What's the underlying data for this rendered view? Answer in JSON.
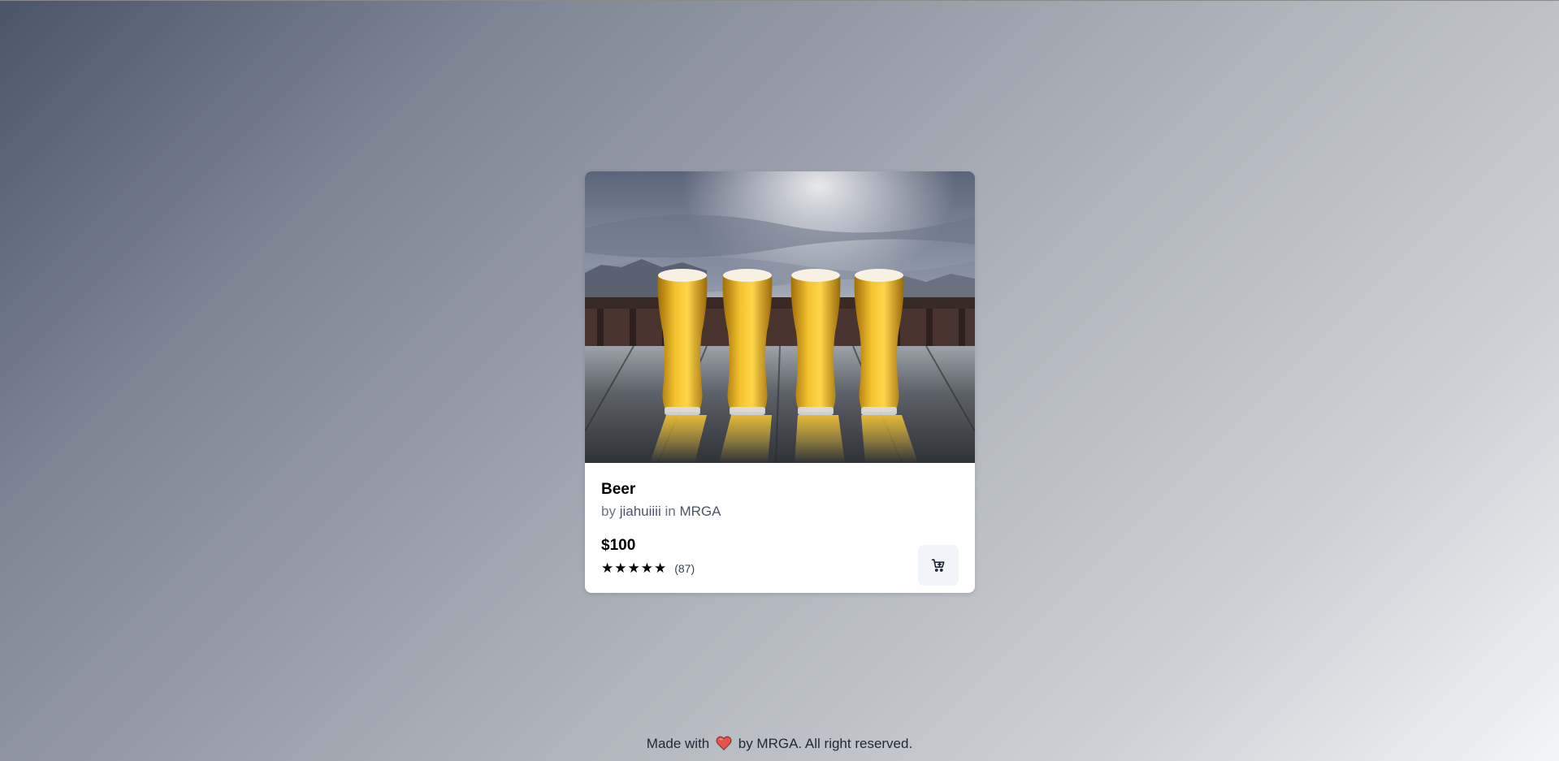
{
  "product": {
    "title": "Beer",
    "by_prefix": "by",
    "author": "jiahuiiii",
    "in_word": "in",
    "category": "MRGA",
    "price": "$100",
    "rating_stars": "★★★★★",
    "rating_value": 5,
    "rating_count": "(87)"
  },
  "cart_button": {
    "icon": "cart-plus-icon"
  },
  "footer": {
    "prefix": "Made with",
    "heart_icon": "heart-icon",
    "suffix": "by MRGA. All right reserved."
  },
  "colors": {
    "card_background": "#ffffff",
    "cart_button_background": "#f1f4f8",
    "heart": "#e5534b"
  }
}
